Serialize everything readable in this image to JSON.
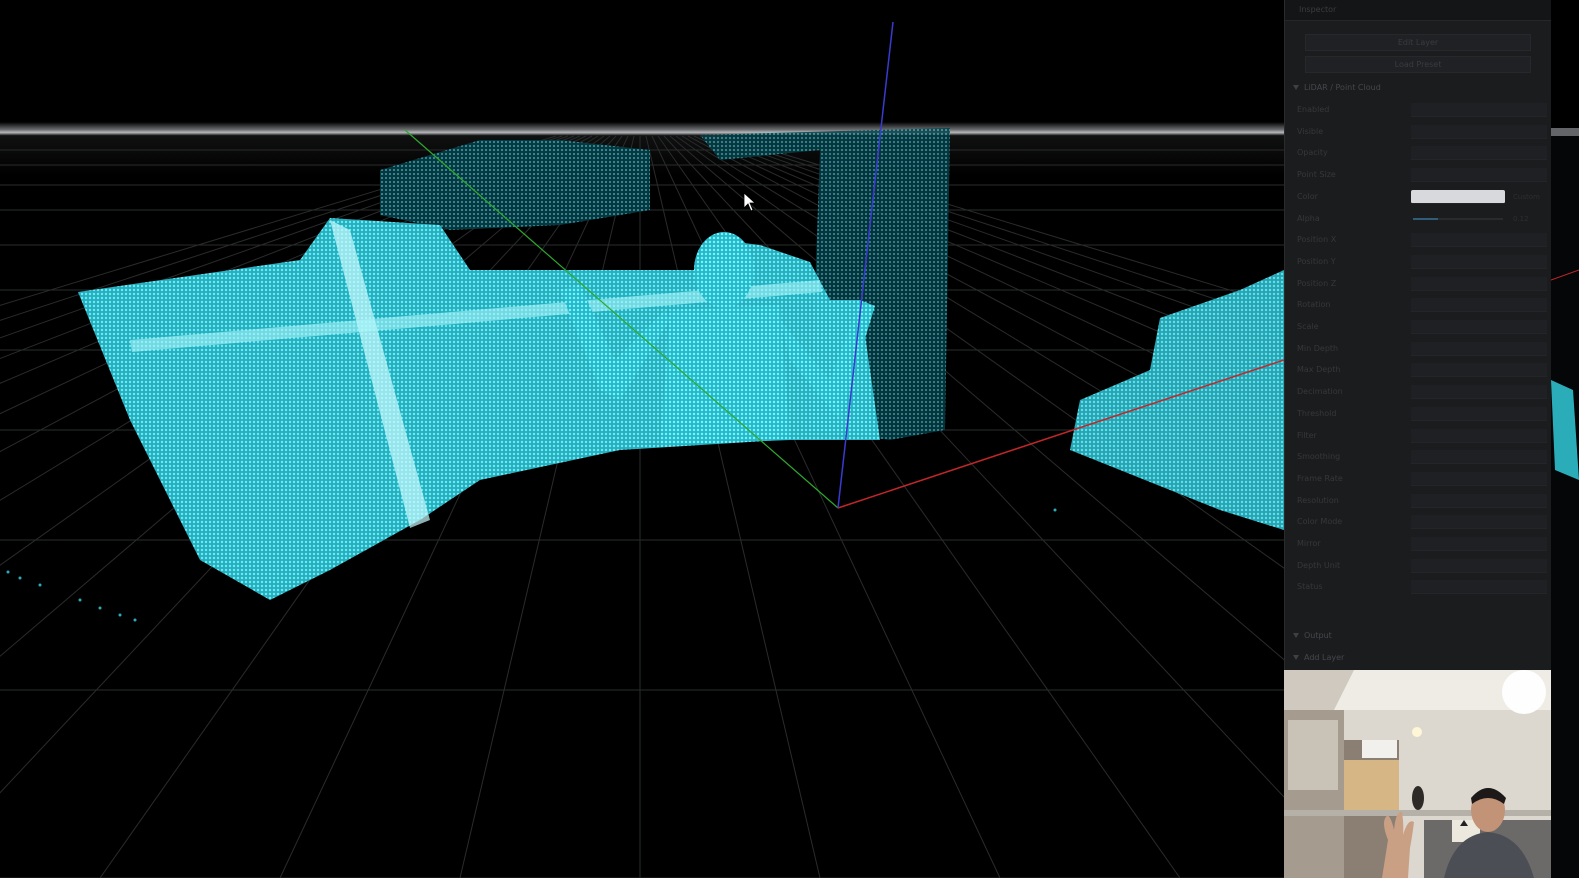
{
  "panel": {
    "title": "Inspector",
    "buttons": [
      "Edit Layer",
      "Load Preset"
    ],
    "section_label": "LiDAR / Point Cloud",
    "rows": [
      {
        "label": "Enabled",
        "value": "",
        "style": "plain"
      },
      {
        "label": "Visible",
        "value": "",
        "style": "plain"
      },
      {
        "label": "Opacity",
        "value": "",
        "style": "plain"
      },
      {
        "label": "Point Size",
        "value": "",
        "style": "plain"
      },
      {
        "label": "Color",
        "value": "",
        "style": "bright",
        "side": "Custom"
      },
      {
        "label": "Alpha",
        "value": "",
        "style": "slider",
        "fraction": 0.28,
        "side": "0.12"
      },
      {
        "label": "Position X",
        "value": "",
        "style": "plain"
      },
      {
        "label": "Position Y",
        "value": "",
        "style": "plain"
      },
      {
        "label": "Position Z",
        "value": "",
        "style": "plain"
      },
      {
        "label": "Rotation",
        "value": "",
        "style": "plain"
      },
      {
        "label": "Scale",
        "value": "",
        "style": "plain"
      },
      {
        "label": "Min Depth",
        "value": "",
        "style": "plain"
      },
      {
        "label": "Max Depth",
        "value": "",
        "style": "plain"
      },
      {
        "label": "Decimation",
        "value": "",
        "style": "plain"
      },
      {
        "label": "Threshold",
        "value": "",
        "style": "plain"
      },
      {
        "label": "Filter",
        "value": "",
        "style": "plain"
      },
      {
        "label": "Smoothing",
        "value": "",
        "style": "plain"
      },
      {
        "label": "Frame Rate",
        "value": "",
        "style": "plain"
      },
      {
        "label": "Resolution",
        "value": "",
        "style": "plain"
      },
      {
        "label": "Color Mode",
        "value": "",
        "style": "plain"
      },
      {
        "label": "Mirror",
        "value": "",
        "style": "plain"
      },
      {
        "label": "Depth Unit",
        "value": "",
        "style": "plain"
      },
      {
        "label": "Status",
        "value": "",
        "style": "accent"
      }
    ],
    "footer_sections": [
      "Output",
      "Add Layer"
    ]
  },
  "viewport": {
    "axis_colors": {
      "x": "#c0262a",
      "y": "#2ea82e",
      "z": "#3a3ad0"
    },
    "point_color": "#35d6e6",
    "horizon_glow": "#9ea0a3"
  },
  "webcam": {
    "caption": ""
  }
}
